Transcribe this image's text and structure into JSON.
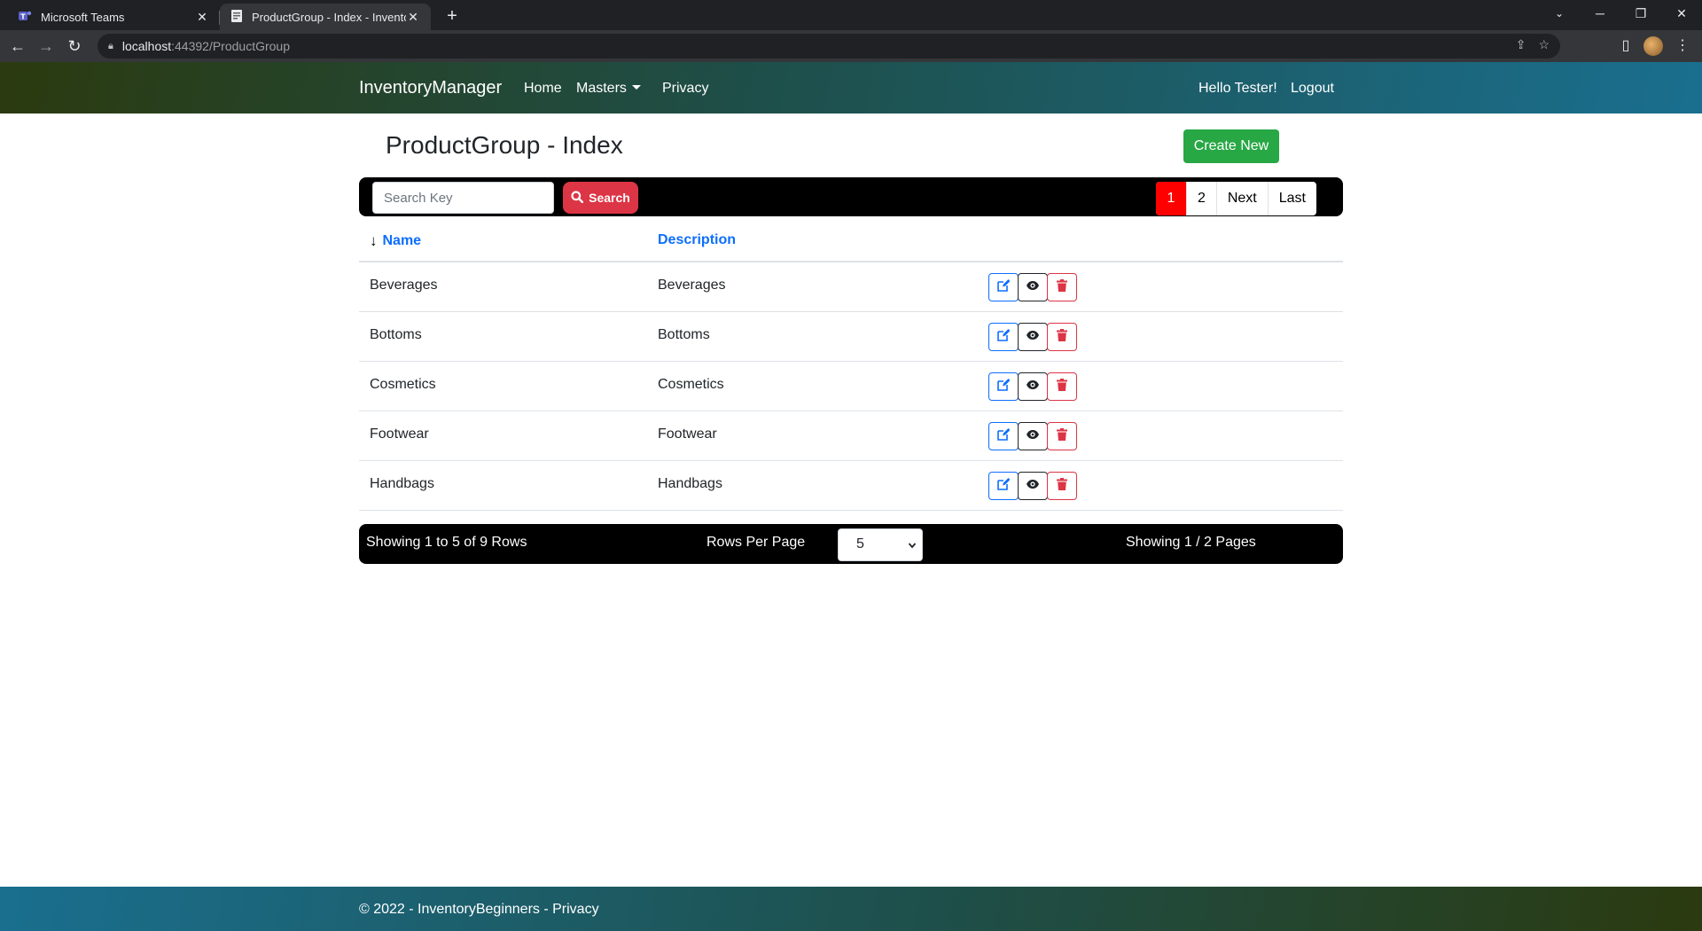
{
  "browser": {
    "tabs": [
      {
        "title": "Microsoft Teams",
        "icon": "teams-icon",
        "active": false
      },
      {
        "title": "ProductGroup - Index - Inventory",
        "icon": "page-icon",
        "active": true
      }
    ],
    "url_host": "localhost",
    "url_rest": ":44392/ProductGroup"
  },
  "navbar": {
    "brand": "InventoryManager",
    "home": "Home",
    "masters": "Masters",
    "privacy": "Privacy",
    "greeting": "Hello Tester!",
    "logout": "Logout"
  },
  "page": {
    "title": "ProductGroup - Index",
    "create_label": "Create New"
  },
  "search": {
    "placeholder": "Search Key",
    "button_label": "Search"
  },
  "pager": {
    "pages": [
      "1",
      "2"
    ],
    "current": "1",
    "next": "Next",
    "last": "Last"
  },
  "table": {
    "columns": [
      "Name",
      "Description"
    ],
    "sort_column": "Name",
    "rows": [
      {
        "name": "Beverages",
        "description": "Beverages"
      },
      {
        "name": "Bottoms",
        "description": "Bottoms"
      },
      {
        "name": "Cosmetics",
        "description": "Cosmetics"
      },
      {
        "name": "Footwear",
        "description": "Footwear"
      },
      {
        "name": "Handbags",
        "description": "Handbags"
      }
    ]
  },
  "summary": {
    "rows_text": "Showing 1 to 5 of 9 Rows",
    "rows_per_page_label": "Rows Per Page",
    "rows_per_page_value": "5",
    "pages_text": "Showing 1 / 2 Pages"
  },
  "footer": {
    "text": "© 2022 - InventoryBeginners - Privacy"
  },
  "colors": {
    "create": "#28a745",
    "search": "#dc3545",
    "active_page": "#ff0000",
    "link": "#0d6efd"
  }
}
